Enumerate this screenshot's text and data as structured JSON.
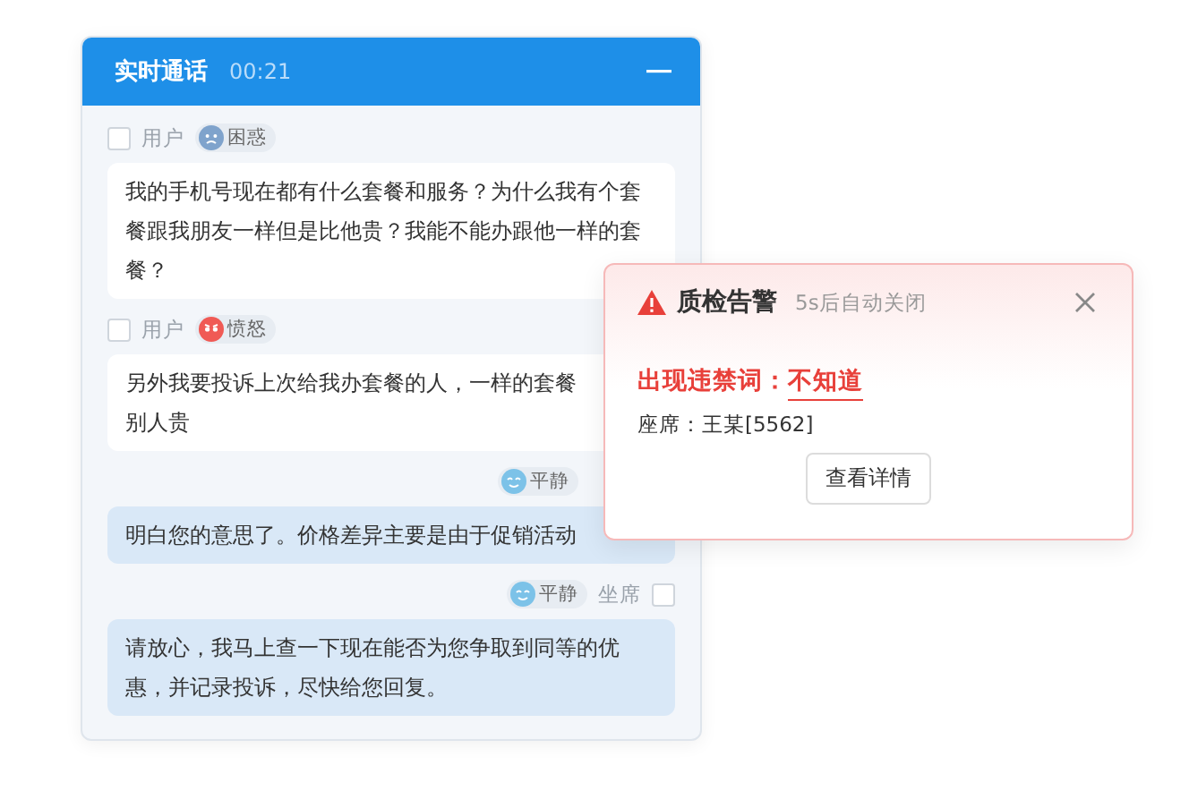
{
  "call_panel": {
    "title": "实时通话",
    "timer": "00:21",
    "messages": [
      {
        "kind": "user",
        "role": "用户",
        "checked": false,
        "emotion": {
          "label": "困惑",
          "kind": "confused",
          "color": "#7fa3cc"
        },
        "lines": [
          "我的手机号现在都有什么套餐和服务？为什么我有个套餐跟我朋友一样但是比他贵？我能不能办跟他一样的套餐？"
        ]
      },
      {
        "kind": "user",
        "role": "用户",
        "checked": false,
        "emotion": {
          "label": "愤怒",
          "kind": "angry",
          "color": "#f05a55"
        },
        "lines": [
          "另外我要投诉上次给我办套餐的人，一样的套餐",
          "别人贵"
        ]
      },
      {
        "kind": "agent",
        "emotion": {
          "label": "平静",
          "kind": "calm",
          "color": "#7cc2e8"
        },
        "lines": [
          "明白您的意思了。价格差异主要是由于促销活动"
        ]
      },
      {
        "kind": "agent",
        "role": "坐席",
        "checked": false,
        "emotion": {
          "label": "平静",
          "kind": "calm",
          "color": "#7cc2e8"
        },
        "lines": [
          "请放心，我马上查一下现在能否为您争取到同等的优惠，并记录投诉，尽快给您回复。"
        ]
      }
    ]
  },
  "alert": {
    "title": "质检告警",
    "subtitle": "5s后自动关闭",
    "violation_label": "出现违禁词：",
    "keyword": "不知道",
    "seat": "座席：王某[5562]",
    "button": "查看详情"
  }
}
